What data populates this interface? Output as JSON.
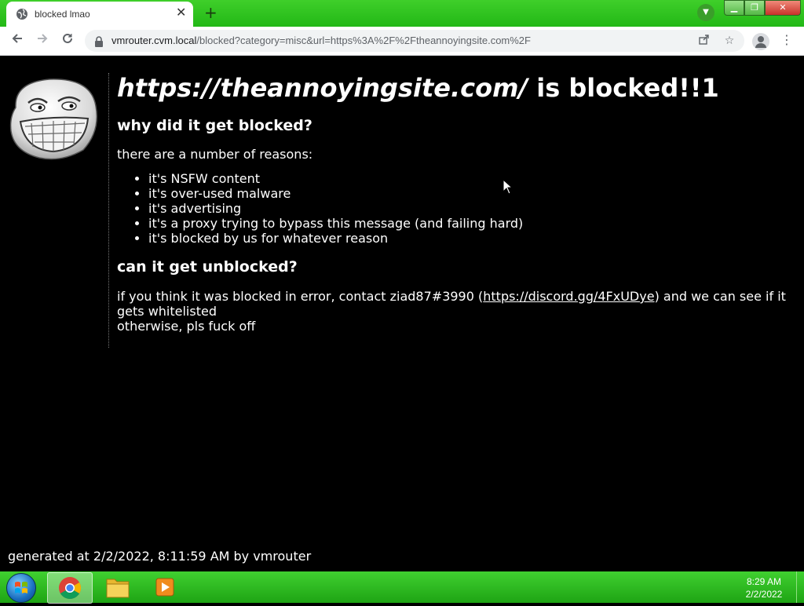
{
  "browser": {
    "tab_title": "blocked lmao",
    "tab_close": "✕",
    "new_tab": "+",
    "url_host": "vmrouter.cvm.local",
    "url_path": "/blocked?category=misc&url=https%3A%2F%2Ftheannoyingsite.com%2F",
    "menu_glyph": "⋮"
  },
  "page": {
    "blocked_url": "https://theannoyingsite.com/",
    "headline_suffix": " is blocked!!1",
    "heading_why": "why did it get blocked?",
    "intro": "there are a number of reasons:",
    "reasons": [
      "it's NSFW content",
      "it's over-used malware",
      "it's advertising",
      "it's a proxy trying to bypass this message (and failing hard)",
      "it's blocked by us for whatever reason"
    ],
    "heading_unblock": "can it get unblocked?",
    "contact_before": "if you think it was blocked in error, contact ziad87#3990 (",
    "contact_link": "https://discord.gg/4FxUDye",
    "contact_after": ") and we can see if it gets whitelisted",
    "otherwise": "otherwise, pls fuck off",
    "footer": "generated at 2/2/2022, 8:11:59 AM by vmrouter"
  },
  "taskbar": {
    "time": "8:29 AM",
    "date": "2/2/2022"
  },
  "icons": {
    "tab": "globe-icon",
    "toolbar": [
      "back-arrow-icon",
      "forward-arrow-icon",
      "reload-icon",
      "lock-icon",
      "share-icon",
      "star-icon",
      "profile-icon",
      "kebab-menu-icon"
    ],
    "taskbar": [
      "windows-start-icon",
      "chrome-icon",
      "file-explorer-icon",
      "media-player-icon"
    ]
  },
  "colors": {
    "theme_green": "#22b816",
    "page_background": "#000000",
    "page_text": "#ffffff"
  }
}
